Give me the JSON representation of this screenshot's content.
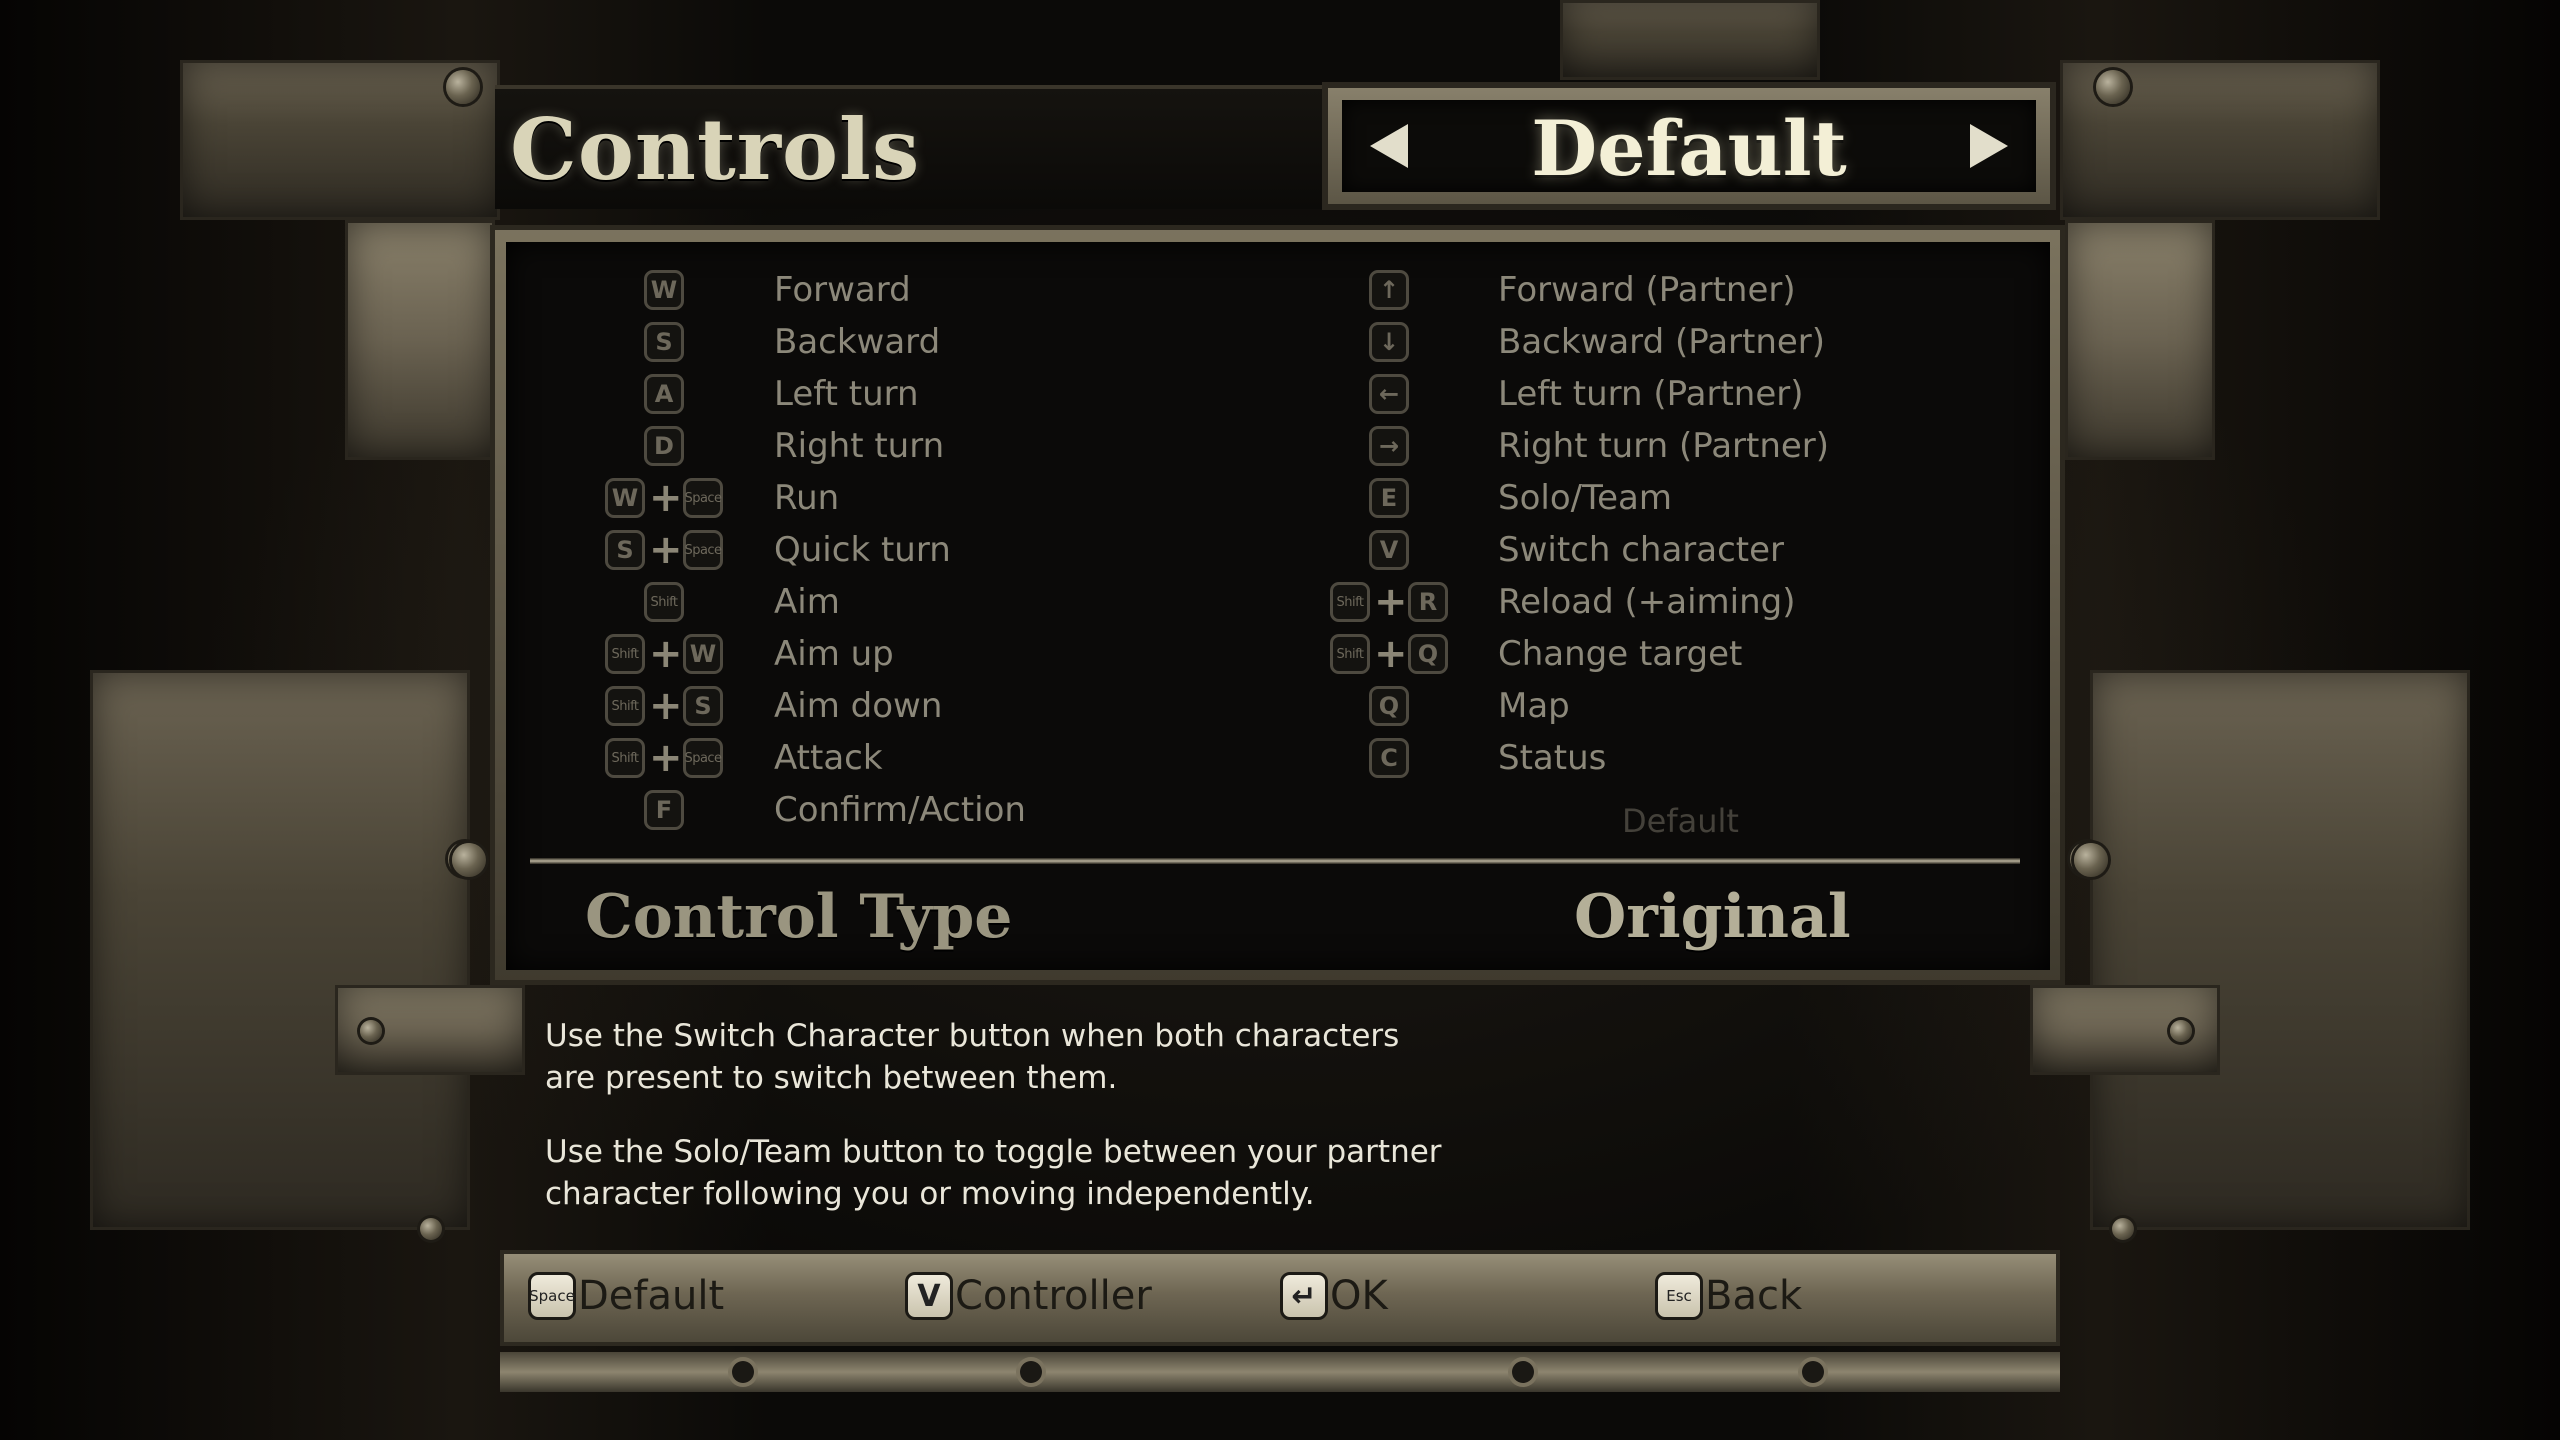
{
  "header": {
    "title": "Controls",
    "preset": "Default",
    "prev_icon": "arrow-left-icon",
    "next_icon": "arrow-right-icon"
  },
  "controls_left": [
    {
      "keys": [
        "W"
      ],
      "label": "Forward"
    },
    {
      "keys": [
        "S"
      ],
      "label": "Backward"
    },
    {
      "keys": [
        "A"
      ],
      "label": "Left turn"
    },
    {
      "keys": [
        "D"
      ],
      "label": "Right turn"
    },
    {
      "keys": [
        "W",
        "Space"
      ],
      "label": "Run"
    },
    {
      "keys": [
        "S",
        "Space"
      ],
      "label": "Quick turn"
    },
    {
      "keys": [
        "Shift"
      ],
      "label": "Aim"
    },
    {
      "keys": [
        "Shift",
        "W"
      ],
      "label": "Aim up"
    },
    {
      "keys": [
        "Shift",
        "S"
      ],
      "label": "Aim down"
    },
    {
      "keys": [
        "Shift",
        "Space"
      ],
      "label": "Attack"
    },
    {
      "keys": [
        "F"
      ],
      "label": "Confirm/Action"
    }
  ],
  "controls_right": [
    {
      "keys": [
        "↑"
      ],
      "label": "Forward (Partner)"
    },
    {
      "keys": [
        "↓"
      ],
      "label": "Backward (Partner)"
    },
    {
      "keys": [
        "←"
      ],
      "label": "Left turn (Partner)"
    },
    {
      "keys": [
        "→"
      ],
      "label": "Right turn (Partner)"
    },
    {
      "keys": [
        "E"
      ],
      "label": "Solo/Team"
    },
    {
      "keys": [
        "V"
      ],
      "label": "Switch character"
    },
    {
      "keys": [
        "Shift",
        "R"
      ],
      "label": "Reload (+aiming)"
    },
    {
      "keys": [
        "Shift",
        "Q"
      ],
      "label": "Change target"
    },
    {
      "keys": [
        "Q"
      ],
      "label": "Map"
    },
    {
      "keys": [
        "C"
      ],
      "label": "Status"
    }
  ],
  "plus_symbol": "+",
  "preset_note": "Default",
  "control_type": {
    "label": "Control Type",
    "value": "Original"
  },
  "help": {
    "line1": "Use the Switch Character button when both characters are present to switch between them.",
    "line2": "Use the Solo/Team button to toggle between your partner character following you or moving independently."
  },
  "footer": [
    {
      "key": "Space",
      "label": "Default"
    },
    {
      "key": "V",
      "label": "Controller"
    },
    {
      "key": "↵",
      "label": "OK"
    },
    {
      "key": "Esc",
      "label": "Back"
    }
  ],
  "colors": {
    "panel_bg": "#0b0a09",
    "label_text": "#8c887a",
    "title_text": "#d9d4b8",
    "help_text": "#e9e6d9",
    "metal": "#6b6352"
  }
}
